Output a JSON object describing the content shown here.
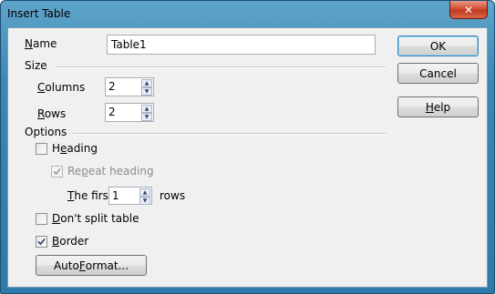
{
  "window": {
    "title": "Insert Table",
    "close_icon": "close-icon"
  },
  "name": {
    "label_u": "N",
    "label_rest": "ame",
    "value": "Table1"
  },
  "size": {
    "section_label": "Size",
    "columns": {
      "label_u": "C",
      "label_rest": "olumns",
      "value": "2"
    },
    "rows": {
      "label_u": "R",
      "label_rest": "ows",
      "value": "2"
    }
  },
  "options": {
    "section_label": "Options",
    "heading": {
      "label_pre": "H",
      "label_u": "e",
      "label_rest": "ading",
      "checked": false
    },
    "repeat_heading": {
      "label_pre": "Re",
      "label_u": "p",
      "label_rest": "eat heading",
      "checked": true,
      "enabled": false
    },
    "the_first": {
      "label_u": "T",
      "label_rest": "he first",
      "value": "1",
      "suffix": "rows"
    },
    "dont_split": {
      "label_u": "D",
      "label_rest": "on't split table",
      "checked": false
    },
    "border": {
      "label_u": "B",
      "label_rest": "order",
      "checked": true
    },
    "autoformat": {
      "label_pre": "Auto",
      "label_u": "F",
      "label_rest": "ormat..."
    }
  },
  "buttons": {
    "ok": "OK",
    "cancel": "Cancel",
    "help_u": "H",
    "help_rest": "elp"
  },
  "colors": {
    "title_bar": "#3a86b4",
    "client_bg": "#f0f0f0",
    "close_red": "#c23a1f"
  }
}
